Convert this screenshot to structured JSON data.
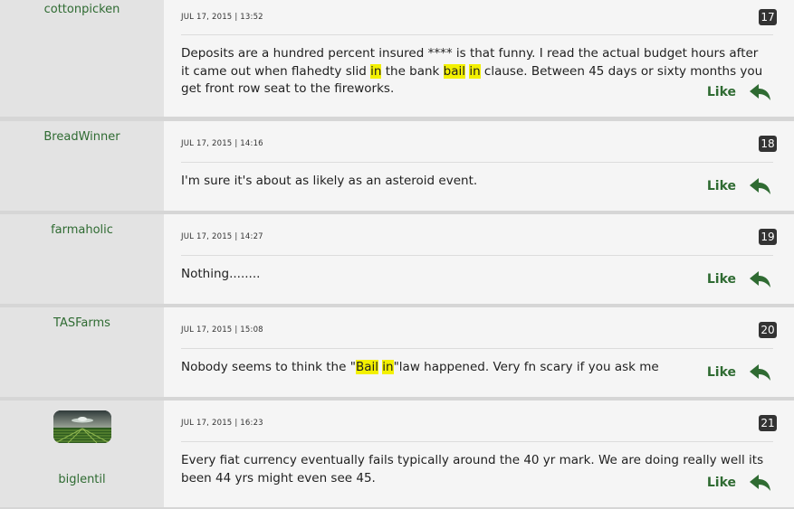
{
  "posts": [
    {
      "username": "cottonpicken",
      "date": "JUL 17, 2015 | 13:52",
      "number": "17",
      "message_parts": [
        {
          "t": "Deposits are a hundred percent insured **** is that funny. I read the actual budget hours after it came out when flahedty slid "
        },
        {
          "t": "in",
          "hl": true
        },
        {
          "t": " the bank "
        },
        {
          "t": "bail",
          "hl": true
        },
        {
          "t": " "
        },
        {
          "t": "in",
          "hl": true
        },
        {
          "t": " clause. Between 45 days or sixty months you get front row seat to the fireworks."
        }
      ],
      "like_label": "Like"
    },
    {
      "username": "BreadWinner",
      "date": "JUL 17, 2015 | 14:16",
      "number": "18",
      "message_parts": [
        {
          "t": "I'm sure it's about as likely as an asteroid event."
        }
      ],
      "like_label": "Like"
    },
    {
      "username": "farmaholic",
      "date": "JUL 17, 2015 | 14:27",
      "number": "19",
      "message_parts": [
        {
          "t": "Nothing........"
        }
      ],
      "like_label": "Like"
    },
    {
      "username": "TASFarms",
      "date": "JUL 17, 2015 | 15:08",
      "number": "20",
      "message_parts": [
        {
          "t": "Nobody seems to think the \""
        },
        {
          "t": "Bail",
          "hl": true
        },
        {
          "t": " "
        },
        {
          "t": "in",
          "hl": true
        },
        {
          "t": "\"law happened. Very fn scary if you ask me"
        }
      ],
      "like_label": "Like"
    },
    {
      "username": "biglentil",
      "date": "JUL 17, 2015 | 16:23",
      "number": "21",
      "message_parts": [
        {
          "t": "Every fiat currency eventually fails typically around the 40 yr mark. We are doing really well its been 44 yrs might even see 45."
        }
      ],
      "like_label": "Like",
      "has_avatar": true
    }
  ],
  "icons": {
    "reply": "reply-arrow-icon",
    "avatar": "ufo-over-field-avatar"
  },
  "colors": {
    "accent": "#2f6b32",
    "highlight": "#f3f000",
    "badge": "#333333",
    "user_column": "#e3e3e3",
    "content_background": "#f5f5f5",
    "separator": "#d6d6d6"
  }
}
